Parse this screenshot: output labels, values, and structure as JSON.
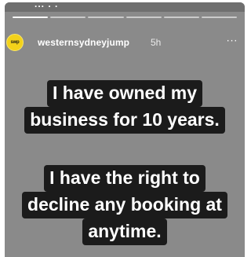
{
  "story": {
    "status_time": "... . .",
    "progress_segments": 6,
    "active_segments": 1
  },
  "header": {
    "avatar_text": "swp",
    "username": "westernsydneyjump",
    "timestamp": "5h",
    "more_icon": "more-horizontal-icon",
    "more_label": "···"
  },
  "caption": {
    "block1": [
      "I have owned my",
      "business for 10 years."
    ],
    "block2": [
      "I have the right to",
      "decline any booking at",
      "anytime."
    ]
  },
  "colors": {
    "background": "#8a8a8a",
    "caption_bg": "#1b1b1b",
    "caption_text": "#ffffff",
    "avatar": "#f3d21a"
  }
}
